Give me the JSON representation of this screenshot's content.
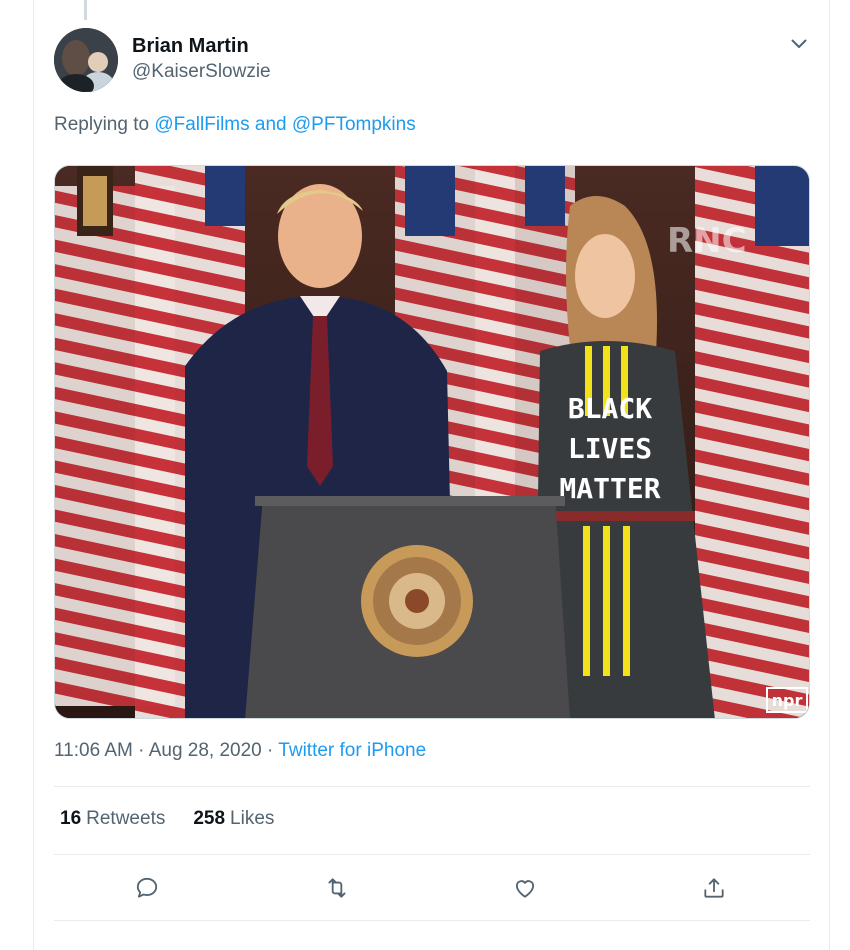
{
  "tweet": {
    "display_name": "Brian Martin",
    "handle": "@KaiserSlowzie",
    "replying_prefix": "Replying to ",
    "replying_users": "@FallFilms and @PFTompkins",
    "timestamp": "11:06 AM · Aug 28, 2020 · ",
    "source": "Twitter for iPhone",
    "retweet_count": "16",
    "retweet_label": "Retweets",
    "like_count": "258",
    "like_label": "Likes"
  },
  "media": {
    "dress_text": [
      "BLACK",
      "LIVES",
      "MATTER"
    ],
    "watermark": "RNC",
    "corner_logo": "npr"
  },
  "icons": {
    "reply": "reply-icon",
    "retweet": "retweet-icon",
    "like": "heart-icon",
    "share": "share-icon",
    "menu": "chevron-down-icon"
  },
  "colors": {
    "accent": "#1d9bf0",
    "secondary_text": "#536471"
  }
}
